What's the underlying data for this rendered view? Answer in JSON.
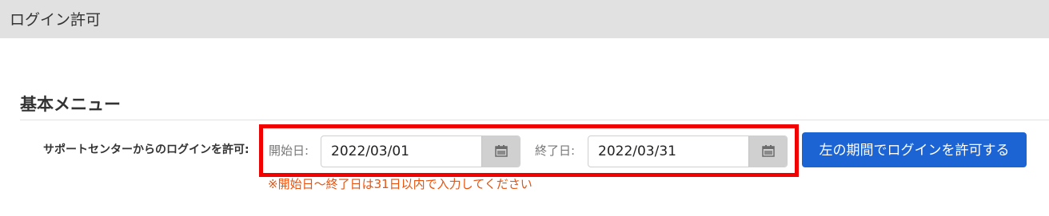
{
  "header": {
    "title": "ログイン許可"
  },
  "section": {
    "title": "基本メニュー"
  },
  "form": {
    "row_label": "サポートセンターからのログインを許可:",
    "start": {
      "label": "開始日:",
      "value": "2022/03/01",
      "icon": "calendar-icon"
    },
    "end": {
      "label": "終了日:",
      "value": "2022/03/31",
      "icon": "calendar-icon"
    },
    "submit_label": "左の期間でログインを許可する",
    "note": "※開始日～終了日は31日以内で入力してください"
  },
  "colors": {
    "header_bg": "#e1e1e1",
    "highlight": "#f20000",
    "button": "#1c63d3",
    "note": "#e8530e"
  }
}
